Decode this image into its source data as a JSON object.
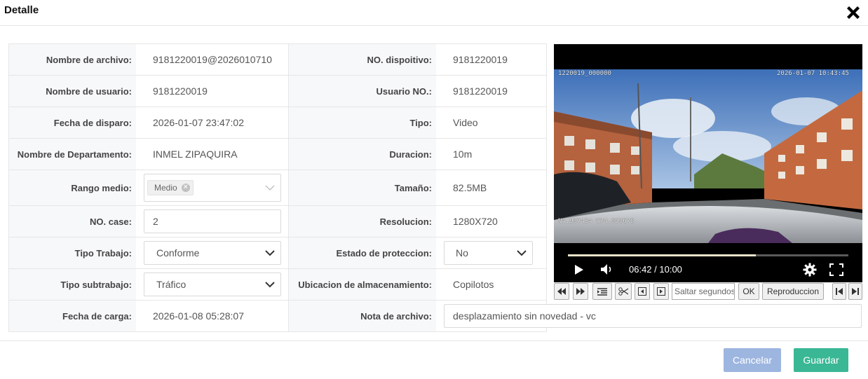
{
  "dialog": {
    "title": "Detalle"
  },
  "fields": {
    "nombre_archivo": {
      "label": "Nombre de archivo:",
      "value": "9181220019@2026010710"
    },
    "no_dispositivo": {
      "label": "NO. dispoitivo:",
      "value": "9181220019"
    },
    "nombre_usuario": {
      "label": "Nombre de usuario:",
      "value": "9181220019"
    },
    "usuario_no": {
      "label": "Usuario NO.:",
      "value": "9181220019"
    },
    "fecha_disparo": {
      "label": "Fecha de disparo:",
      "value": "2026-01-07 23:47:02"
    },
    "tipo": {
      "label": "Tipo:",
      "value": "Video"
    },
    "departamento": {
      "label": "Nombre de Departamento:",
      "value": "INMEL ZIPAQUIRA"
    },
    "duracion": {
      "label": "Duracion:",
      "value": "10m"
    },
    "rango_medio": {
      "label": "Rango medio:",
      "tag": "Medio"
    },
    "tamano": {
      "label": "Tamaño:",
      "value": "82.5MB"
    },
    "no_case": {
      "label": "NO. case:",
      "value": "2"
    },
    "resolucion": {
      "label": "Resolucion:",
      "value": "1280X720"
    },
    "tipo_trabajo": {
      "label": "Tipo Trabajo:",
      "value": "Conforme"
    },
    "estado_proteccion": {
      "label": "Estado de proteccion:",
      "value": "No"
    },
    "tipo_subtrabajo": {
      "label": "Tipo subtrabajo:",
      "value": "Tráfico"
    },
    "ubicacion": {
      "label": "Ubicacion de almacenamiento:",
      "value": "Copilotos"
    },
    "fecha_carga": {
      "label": "Fecha de carga:",
      "value": "2026-01-08 05:28:07"
    },
    "nota_archivo": {
      "label": "Nota de archivo:",
      "value": "desplazamiento sin novedad - vc"
    }
  },
  "video": {
    "osd_id": "1220019_000000",
    "osd_datetime": "2026-01-07  10:43:45",
    "osd_gps": "N4.907434  W74.099678",
    "time": "06:42 / 10:00",
    "progress_fraction": 0.67
  },
  "toolbar": {
    "seek_placeholder": "Saltar segundos",
    "ok_label": "OK",
    "play_label": "Reproduccion"
  },
  "buttons": {
    "cancel": "Cancelar",
    "save": "Guardar"
  },
  "colors": {
    "cancel": "#9db6e0",
    "save": "#3ab795",
    "label_bg": "#f7f8fa"
  },
  "icons": [
    "close-icon",
    "play-icon",
    "volume-icon",
    "settings-icon",
    "fullscreen-icon",
    "rewind-icon",
    "fast-forward-icon",
    "list-icon",
    "scissors-icon",
    "prev-frame-icon",
    "next-frame-icon",
    "skip-start-icon",
    "skip-end-icon",
    "chevron-down-icon",
    "tag-remove-icon"
  ]
}
